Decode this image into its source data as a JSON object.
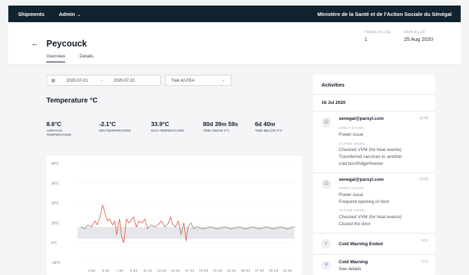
{
  "topbar": {
    "shipments": "Shipments",
    "admin": "Admin",
    "org": "Ministère de la Santé et de l'Action Sociale du Sénégal"
  },
  "header": {
    "title": "Peycouck",
    "tabs": [
      "Overview",
      "Details"
    ],
    "treks_label": "TREKS IN USE",
    "treks_value": "1",
    "data_label": "DATA AS OF",
    "data_value": "25 Aug 2020"
  },
  "filters": {
    "date_from": "2020-07-01",
    "date_sep": "-",
    "date_to": "2020-07-31",
    "trek": "Trek 42-FEA"
  },
  "section_title": "Temperature °C",
  "stats": [
    {
      "value": "8.6°C",
      "label": "Average temperature"
    },
    {
      "value": "-2.1°C",
      "label": "Min temperature"
    },
    {
      "value": "33.9°C",
      "label": "Max temperature"
    },
    {
      "value": "80d 39m 59s",
      "label": "Time above 8°C"
    },
    {
      "value": "6d 40m",
      "label": "Time below 2°C"
    }
  ],
  "chart_data": {
    "type": "line",
    "y_ticks": [
      "40°C",
      "30°C",
      "20°C",
      "10°C",
      "0°C",
      "-10°C"
    ],
    "x_ticks": [
      "3 Jul",
      "5 Jul",
      "7 Jul",
      "9 Jul",
      "11 Jul",
      "13 Jul",
      "15 Jul",
      "17 Jul",
      "19 Jul",
      "21 Jul",
      "23 Jul",
      "25 Jul",
      "27 Jul",
      "29 Jul",
      "31 Jul"
    ],
    "ylim": [
      -10,
      40
    ],
    "xlim": [
      1,
      32
    ],
    "safe_range": [
      2,
      8
    ],
    "x": [
      1.5,
      2.0,
      2.5,
      3.0,
      3.5,
      3.8,
      4.2,
      4.6,
      5.0,
      5.3,
      5.6,
      6.0,
      6.3,
      6.6,
      7.0,
      7.3,
      7.6,
      8.0,
      8.3,
      8.6,
      9.0,
      9.4,
      9.8,
      10.2,
      10.6,
      11.0,
      11.5,
      12.0,
      12.5,
      13.0,
      13.5,
      14.0,
      14.3,
      14.6,
      15.0,
      15.4,
      15.8,
      16.2,
      16.5,
      16.8,
      17.2,
      17.6,
      18.0,
      19.0,
      20.0,
      21.0,
      22.0,
      23.0,
      24.0,
      25.0,
      26.0,
      27.0,
      28.0,
      29.0,
      30.0,
      31.0,
      32.0
    ],
    "y": [
      8,
      7,
      9,
      8,
      11,
      9,
      13,
      19,
      14,
      11,
      12,
      9,
      11,
      4,
      12,
      3,
      0,
      12,
      10,
      11,
      13,
      8,
      11,
      10,
      12,
      7,
      9,
      8,
      9,
      11,
      8,
      10,
      13,
      9,
      8,
      11,
      4,
      10,
      1,
      8,
      10,
      7,
      8,
      7,
      8,
      7,
      8,
      7,
      8,
      7,
      8,
      7,
      8,
      7,
      8,
      7,
      8
    ],
    "series_colors": {
      "in_range": "#8a8a8a",
      "excursion": "#e05a3f",
      "band": "#e5e7eb"
    }
  },
  "activities": {
    "title": "Activities",
    "date": "16 Jul 2020",
    "events": [
      {
        "email": "senegal@parsyl.com",
        "time": "12:45",
        "cause_label": "LIKELY CAUSE",
        "cause": [
          "Power issue"
        ],
        "action_label": "ACTION TAKEN",
        "action": [
          "Checked VVM (for heat events)",
          "Transferred vaccines to another",
          "cold box/fridge/freezer"
        ]
      },
      {
        "email": "senegal@parsyl.com",
        "time": "12:33",
        "cause_label": "LIKELY CAUSE",
        "cause": [
          "Power issue",
          "Frequent opening of door"
        ],
        "action_label": "ACTION TAKEN",
        "action": [
          "Checked VVM (for heat events)",
          "Closed the door"
        ]
      }
    ],
    "warning_ended": {
      "title": "Cold Warning Ended",
      "time": "9:15"
    },
    "warning": {
      "title": "Cold Warning",
      "time": "4:13",
      "link": "See details"
    }
  }
}
